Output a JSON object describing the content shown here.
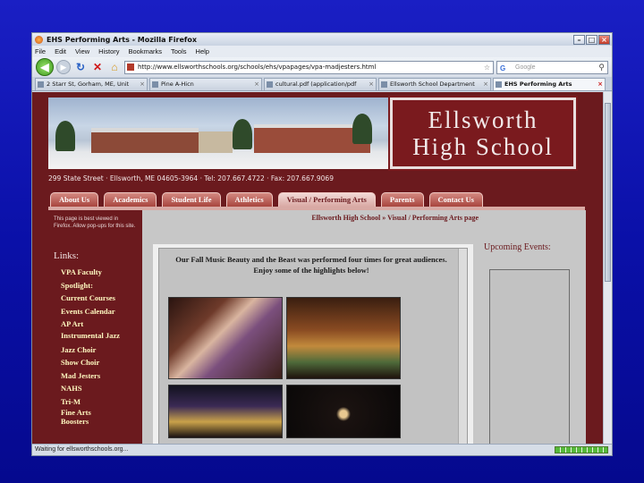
{
  "browser": {
    "window_title": "EHS Performing Arts - Mozilla Firefox",
    "menu": [
      "File",
      "Edit",
      "View",
      "History",
      "Bookmarks",
      "Tools",
      "Help"
    ],
    "url": "http://www.ellsworthschools.org/schools/ehs/vpapages/vpa-madjesters.html",
    "search_placeholder": "Google",
    "tabs": [
      {
        "label": "2 Starr St, Gorham, ME, Unit",
        "active": false
      },
      {
        "label": "Pine A-Hicn",
        "active": false
      },
      {
        "label": "cultural.pdf (application/pdf",
        "active": false
      },
      {
        "label": "Ellsworth School Department",
        "active": false
      },
      {
        "label": "EHS Performing Arts",
        "active": true
      }
    ],
    "status": "Waiting for ellsworthschools.org...",
    "icons": [
      "firefox-icon",
      "back-icon",
      "forward-icon",
      "reload-icon",
      "stop-icon",
      "home-icon",
      "star-icon",
      "search-icon"
    ]
  },
  "site": {
    "logo_line1": "Ellsworth",
    "logo_line2": "High School",
    "address": "299 State Street · Ellsworth, ME 04605-3964 · Tel: 207.667.4722 · Fax: 207.667.9069",
    "nav": [
      {
        "label": "About Us",
        "active": false
      },
      {
        "label": "Academics",
        "active": false
      },
      {
        "label": "Student Life",
        "active": false
      },
      {
        "label": "Athletics",
        "active": false
      },
      {
        "label": "Visual / Performing Arts",
        "active": true
      },
      {
        "label": "Parents",
        "active": false
      },
      {
        "label": "Contact Us",
        "active": false
      }
    ],
    "firefox_note": "This page is best viewed in Firefox. Allow pop-ups for this site.",
    "links_heading": "Links:",
    "links": [
      "VPA Faculty",
      "Spotlight:",
      "Current Courses",
      "Events Calendar",
      "AP Art",
      "Instrumental Jazz",
      "Jazz Choir",
      "Show Choir",
      "Mad Jesters",
      "NAHS",
      "Tri-M",
      "Fine Arts Boosters"
    ],
    "breadcrumb": "Ellsworth High School » Visual / Performing Arts page",
    "intro": "Our Fall Music Beauty and the Beast was performed four times for great audiences.  Enjoy some of the highlights below!",
    "upcoming_events": "Upcoming Events:"
  }
}
